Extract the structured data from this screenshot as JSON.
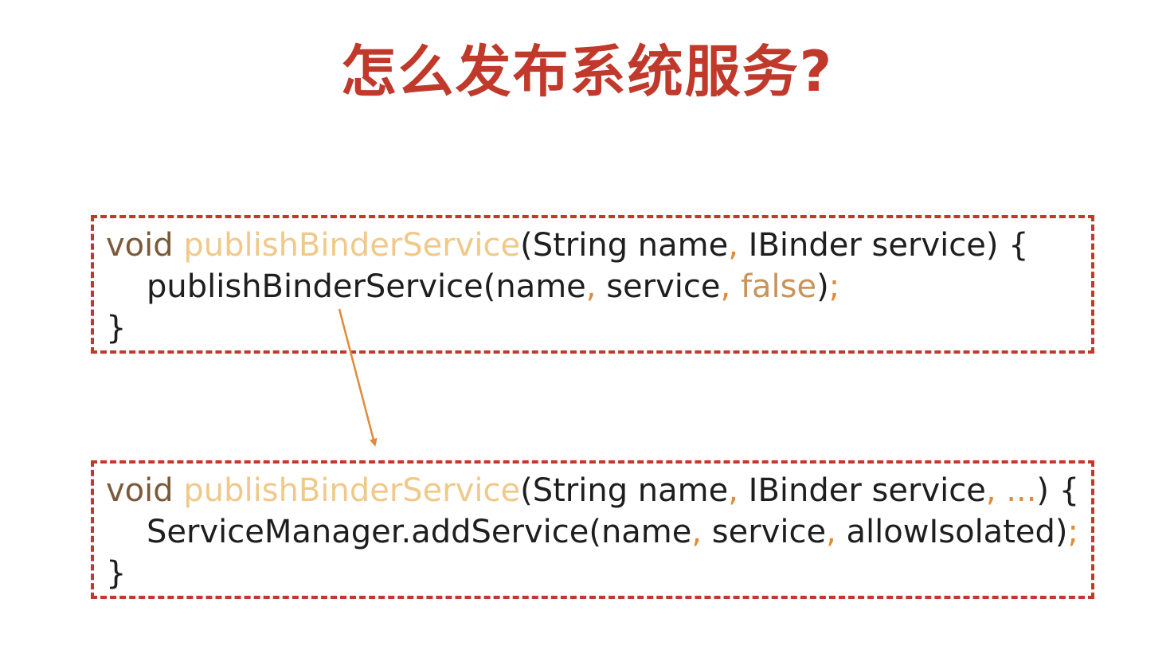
{
  "colors": {
    "title": "#c0392b",
    "box_border": "#c0392b",
    "code_text": "#1e1e1e",
    "keyword": "#7a5a3a",
    "method_name": "#f0c98a",
    "punctuation": "#e08a3a",
    "boolean": "#c8945a",
    "arrow": "#e08a3a"
  },
  "title": "怎么发布系统服务?",
  "code_blocks": [
    {
      "lines": [
        [
          {
            "text": "void",
            "kind": "keyword"
          },
          {
            "text": " ",
            "kind": "plain"
          },
          {
            "text": "publishBinderService",
            "kind": "method"
          },
          {
            "text": "(String name",
            "kind": "plain"
          },
          {
            "text": ",",
            "kind": "punct"
          },
          {
            "text": " IBinder service) {",
            "kind": "plain"
          }
        ],
        [
          {
            "text": "publishBinderService(name",
            "kind": "plain"
          },
          {
            "text": ",",
            "kind": "punct"
          },
          {
            "text": " service",
            "kind": "plain"
          },
          {
            "text": ",",
            "kind": "punct"
          },
          {
            "text": " ",
            "kind": "plain"
          },
          {
            "text": "false",
            "kind": "bool"
          },
          {
            "text": ")",
            "kind": "plain"
          },
          {
            "text": ";",
            "kind": "punct"
          }
        ],
        [
          {
            "text": "}",
            "kind": "plain"
          }
        ]
      ]
    },
    {
      "lines": [
        [
          {
            "text": "void",
            "kind": "keyword"
          },
          {
            "text": " ",
            "kind": "plain"
          },
          {
            "text": "publishBinderService",
            "kind": "method"
          },
          {
            "text": "(String name",
            "kind": "plain"
          },
          {
            "text": ",",
            "kind": "punct"
          },
          {
            "text": " IBinder service",
            "kind": "plain"
          },
          {
            "text": ", ...",
            "kind": "punct"
          },
          {
            "text": ") {",
            "kind": "plain"
          }
        ],
        [
          {
            "text": "ServiceManager.addService(name",
            "kind": "plain"
          },
          {
            "text": ",",
            "kind": "punct"
          },
          {
            "text": " service",
            "kind": "plain"
          },
          {
            "text": ",",
            "kind": "punct"
          },
          {
            "text": " allowIsolated)",
            "kind": "plain"
          },
          {
            "text": ";",
            "kind": "punct"
          }
        ],
        [
          {
            "text": "}",
            "kind": "plain"
          }
        ]
      ]
    }
  ]
}
